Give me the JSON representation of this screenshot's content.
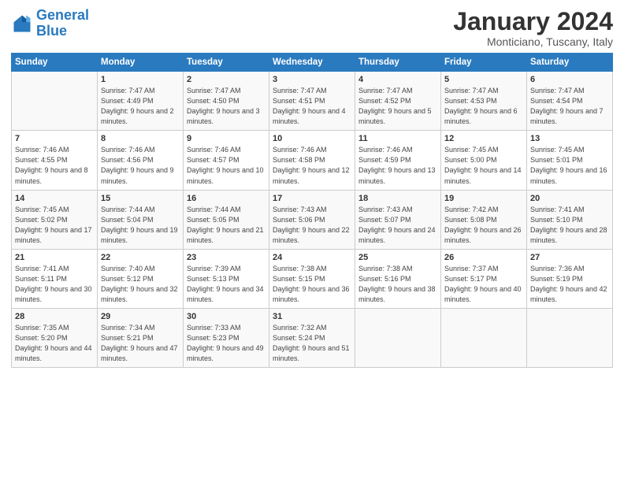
{
  "logo": {
    "line1": "General",
    "line2": "Blue"
  },
  "title": "January 2024",
  "subtitle": "Monticiano, Tuscany, Italy",
  "days_header": [
    "Sunday",
    "Monday",
    "Tuesday",
    "Wednesday",
    "Thursday",
    "Friday",
    "Saturday"
  ],
  "weeks": [
    [
      {
        "day": "",
        "sunrise": "",
        "sunset": "",
        "daylight": ""
      },
      {
        "day": "1",
        "sunrise": "Sunrise: 7:47 AM",
        "sunset": "Sunset: 4:49 PM",
        "daylight": "Daylight: 9 hours and 2 minutes."
      },
      {
        "day": "2",
        "sunrise": "Sunrise: 7:47 AM",
        "sunset": "Sunset: 4:50 PM",
        "daylight": "Daylight: 9 hours and 3 minutes."
      },
      {
        "day": "3",
        "sunrise": "Sunrise: 7:47 AM",
        "sunset": "Sunset: 4:51 PM",
        "daylight": "Daylight: 9 hours and 4 minutes."
      },
      {
        "day": "4",
        "sunrise": "Sunrise: 7:47 AM",
        "sunset": "Sunset: 4:52 PM",
        "daylight": "Daylight: 9 hours and 5 minutes."
      },
      {
        "day": "5",
        "sunrise": "Sunrise: 7:47 AM",
        "sunset": "Sunset: 4:53 PM",
        "daylight": "Daylight: 9 hours and 6 minutes."
      },
      {
        "day": "6",
        "sunrise": "Sunrise: 7:47 AM",
        "sunset": "Sunset: 4:54 PM",
        "daylight": "Daylight: 9 hours and 7 minutes."
      }
    ],
    [
      {
        "day": "7",
        "sunrise": "Sunrise: 7:46 AM",
        "sunset": "Sunset: 4:55 PM",
        "daylight": "Daylight: 9 hours and 8 minutes."
      },
      {
        "day": "8",
        "sunrise": "Sunrise: 7:46 AM",
        "sunset": "Sunset: 4:56 PM",
        "daylight": "Daylight: 9 hours and 9 minutes."
      },
      {
        "day": "9",
        "sunrise": "Sunrise: 7:46 AM",
        "sunset": "Sunset: 4:57 PM",
        "daylight": "Daylight: 9 hours and 10 minutes."
      },
      {
        "day": "10",
        "sunrise": "Sunrise: 7:46 AM",
        "sunset": "Sunset: 4:58 PM",
        "daylight": "Daylight: 9 hours and 12 minutes."
      },
      {
        "day": "11",
        "sunrise": "Sunrise: 7:46 AM",
        "sunset": "Sunset: 4:59 PM",
        "daylight": "Daylight: 9 hours and 13 minutes."
      },
      {
        "day": "12",
        "sunrise": "Sunrise: 7:45 AM",
        "sunset": "Sunset: 5:00 PM",
        "daylight": "Daylight: 9 hours and 14 minutes."
      },
      {
        "day": "13",
        "sunrise": "Sunrise: 7:45 AM",
        "sunset": "Sunset: 5:01 PM",
        "daylight": "Daylight: 9 hours and 16 minutes."
      }
    ],
    [
      {
        "day": "14",
        "sunrise": "Sunrise: 7:45 AM",
        "sunset": "Sunset: 5:02 PM",
        "daylight": "Daylight: 9 hours and 17 minutes."
      },
      {
        "day": "15",
        "sunrise": "Sunrise: 7:44 AM",
        "sunset": "Sunset: 5:04 PM",
        "daylight": "Daylight: 9 hours and 19 minutes."
      },
      {
        "day": "16",
        "sunrise": "Sunrise: 7:44 AM",
        "sunset": "Sunset: 5:05 PM",
        "daylight": "Daylight: 9 hours and 21 minutes."
      },
      {
        "day": "17",
        "sunrise": "Sunrise: 7:43 AM",
        "sunset": "Sunset: 5:06 PM",
        "daylight": "Daylight: 9 hours and 22 minutes."
      },
      {
        "day": "18",
        "sunrise": "Sunrise: 7:43 AM",
        "sunset": "Sunset: 5:07 PM",
        "daylight": "Daylight: 9 hours and 24 minutes."
      },
      {
        "day": "19",
        "sunrise": "Sunrise: 7:42 AM",
        "sunset": "Sunset: 5:08 PM",
        "daylight": "Daylight: 9 hours and 26 minutes."
      },
      {
        "day": "20",
        "sunrise": "Sunrise: 7:41 AM",
        "sunset": "Sunset: 5:10 PM",
        "daylight": "Daylight: 9 hours and 28 minutes."
      }
    ],
    [
      {
        "day": "21",
        "sunrise": "Sunrise: 7:41 AM",
        "sunset": "Sunset: 5:11 PM",
        "daylight": "Daylight: 9 hours and 30 minutes."
      },
      {
        "day": "22",
        "sunrise": "Sunrise: 7:40 AM",
        "sunset": "Sunset: 5:12 PM",
        "daylight": "Daylight: 9 hours and 32 minutes."
      },
      {
        "day": "23",
        "sunrise": "Sunrise: 7:39 AM",
        "sunset": "Sunset: 5:13 PM",
        "daylight": "Daylight: 9 hours and 34 minutes."
      },
      {
        "day": "24",
        "sunrise": "Sunrise: 7:38 AM",
        "sunset": "Sunset: 5:15 PM",
        "daylight": "Daylight: 9 hours and 36 minutes."
      },
      {
        "day": "25",
        "sunrise": "Sunrise: 7:38 AM",
        "sunset": "Sunset: 5:16 PM",
        "daylight": "Daylight: 9 hours and 38 minutes."
      },
      {
        "day": "26",
        "sunrise": "Sunrise: 7:37 AM",
        "sunset": "Sunset: 5:17 PM",
        "daylight": "Daylight: 9 hours and 40 minutes."
      },
      {
        "day": "27",
        "sunrise": "Sunrise: 7:36 AM",
        "sunset": "Sunset: 5:19 PM",
        "daylight": "Daylight: 9 hours and 42 minutes."
      }
    ],
    [
      {
        "day": "28",
        "sunrise": "Sunrise: 7:35 AM",
        "sunset": "Sunset: 5:20 PM",
        "daylight": "Daylight: 9 hours and 44 minutes."
      },
      {
        "day": "29",
        "sunrise": "Sunrise: 7:34 AM",
        "sunset": "Sunset: 5:21 PM",
        "daylight": "Daylight: 9 hours and 47 minutes."
      },
      {
        "day": "30",
        "sunrise": "Sunrise: 7:33 AM",
        "sunset": "Sunset: 5:23 PM",
        "daylight": "Daylight: 9 hours and 49 minutes."
      },
      {
        "day": "31",
        "sunrise": "Sunrise: 7:32 AM",
        "sunset": "Sunset: 5:24 PM",
        "daylight": "Daylight: 9 hours and 51 minutes."
      },
      {
        "day": "",
        "sunrise": "",
        "sunset": "",
        "daylight": ""
      },
      {
        "day": "",
        "sunrise": "",
        "sunset": "",
        "daylight": ""
      },
      {
        "day": "",
        "sunrise": "",
        "sunset": "",
        "daylight": ""
      }
    ]
  ]
}
